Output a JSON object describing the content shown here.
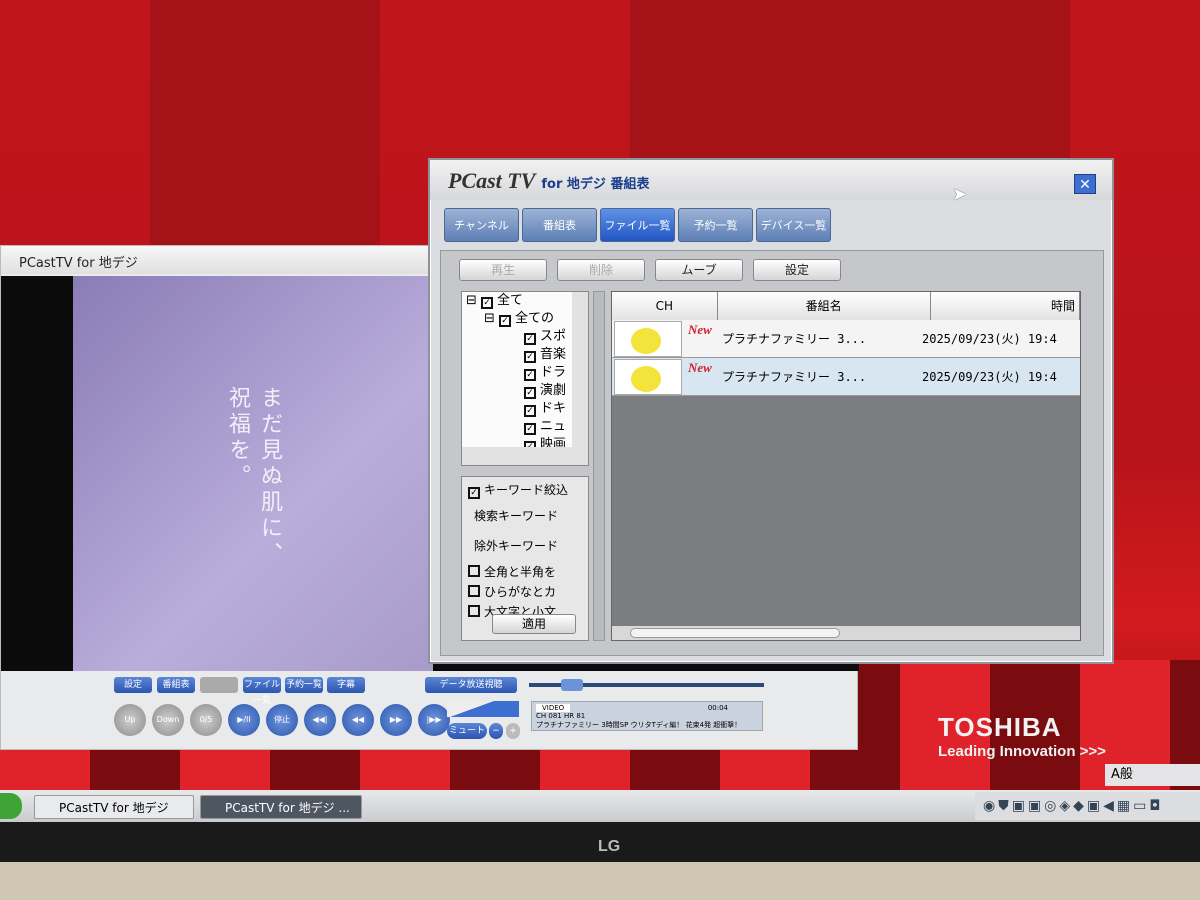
{
  "player": {
    "title": "PCastTV for 地デジ",
    "video_text_1": "まだ見ぬ肌に、",
    "video_text_2": "祝福を。",
    "small_buttons": [
      "設定",
      "番組表",
      "",
      "ファイル一覧",
      "予約一覧",
      "字幕"
    ],
    "data_button": "データ放送視聴",
    "round_buttons": [
      "Up",
      "Down",
      "0/5",
      "▶/II",
      "停止",
      "◀◀|",
      "◀◀",
      "▶▶",
      "|▶▶"
    ],
    "mute": "ミュート",
    "minus": "−",
    "plus": "+",
    "info_mode": "VIDEO",
    "info_time": "00:04",
    "info_ch": "CH 081 HR 81",
    "info_program": "プラチナファミリー 3時間SP ウリタTディ編！ 花束4発 超衝撃！"
  },
  "dialog": {
    "logo": "PCast TV",
    "logo_sub": "for 地デジ 番組表",
    "close": "✕",
    "tabs": [
      "チャンネル",
      "番組表",
      "ファイル一覧",
      "予約一覧",
      "デバイス一覧"
    ],
    "buttons": {
      "play": "再生",
      "delete": "削除",
      "move": "ムーブ",
      "settings": "設定"
    },
    "tree": [
      "全て",
      "全ての",
      "スポ",
      "音楽",
      "ドラ",
      "演劇",
      "ドキ",
      "ニュ",
      "映画"
    ],
    "keyword": {
      "filter": "キーワード絞込",
      "search": "検索キーワード",
      "exclude": "除外キーワード",
      "options": [
        "全角と半角を",
        "ひらがなとカ",
        "大文字と小文"
      ],
      "apply": "適用"
    },
    "columns": [
      "CH",
      "番組名",
      "時間"
    ],
    "rows": [
      {
        "badge": "New",
        "title": "プラチナファミリー 3...",
        "time": "2025/09/23(火) 19:4"
      },
      {
        "badge": "New",
        "title": "プラチナファミリー 3...",
        "time": "2025/09/23(火) 19:4"
      }
    ]
  },
  "wallpaper": {
    "brand": "TOSHIBA",
    "tagline": "Leading Innovation >>>"
  },
  "taskbar": {
    "tasks": [
      "PCastTV for 地デジ",
      "PCastTV for 地デジ ..."
    ],
    "ime": "A般"
  },
  "monitor": {
    "brand": "LG"
  }
}
